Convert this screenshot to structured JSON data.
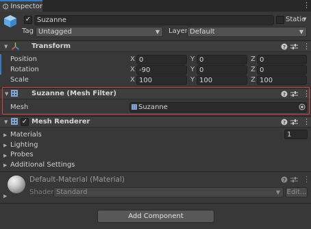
{
  "tab": {
    "title": "Inspector"
  },
  "object": {
    "name": "Suzanne",
    "static_label": "Static",
    "tag_label": "Tag",
    "tag_value": "Untagged",
    "layer_label": "Layer",
    "layer_value": "Default"
  },
  "transform": {
    "title": "Transform",
    "rows": [
      {
        "label": "Position",
        "x": "0",
        "y": "0",
        "z": "0"
      },
      {
        "label": "Rotation",
        "x": "-90",
        "y": "0",
        "z": "0"
      },
      {
        "label": "Scale",
        "x": "100",
        "y": "100",
        "z": "100"
      }
    ],
    "axis_x": "X",
    "axis_y": "Y",
    "axis_z": "Z"
  },
  "mesh_filter": {
    "title": "Suzanne (Mesh Filter)",
    "mesh_label": "Mesh",
    "mesh_value": "Suzanne"
  },
  "mesh_renderer": {
    "title": "Mesh Renderer",
    "sections": [
      "Materials",
      "Lighting",
      "Probes",
      "Additional Settings"
    ],
    "materials_count": "1"
  },
  "material": {
    "name": "Default-Material (Material)",
    "shader_label": "Shader",
    "shader_value": "Standard",
    "edit_label": "Edit..."
  },
  "footer": {
    "add_component_label": "Add Component"
  },
  "colors": {
    "accent": "#3a79bb",
    "highlight": "#e0443a"
  },
  "icons": {
    "help": "question-circle-icon",
    "presets": "sliders-icon",
    "menu": "vertical-dots-icon"
  }
}
